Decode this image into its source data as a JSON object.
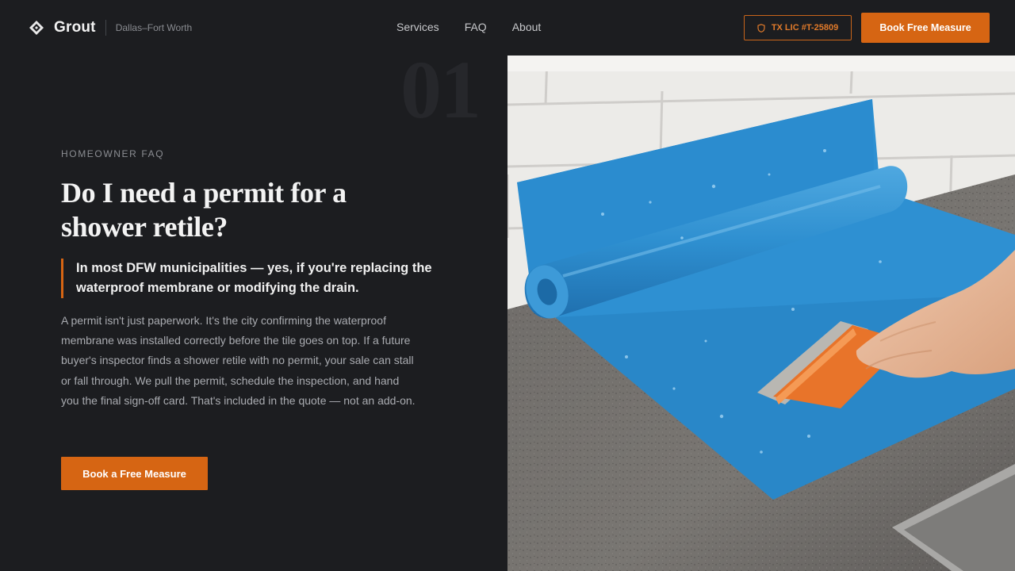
{
  "header": {
    "brand_name": "Grout",
    "city": "Dallas–Fort Worth",
    "nav": [
      "Services",
      "FAQ",
      "About"
    ],
    "license": "TX LIC #T-25809",
    "book_button": "Book Free Measure"
  },
  "hero": {
    "section_number": "01",
    "eyebrow": "HOMEOWNER FAQ",
    "headline": "Do I need a permit for a shower retile?",
    "callout": "In most DFW municipalities — yes, if you're replacing the waterproof membrane or modifying the drain.",
    "body": "A permit isn't just paperwork. It's the city confirming the waterproof membrane was installed correctly before the tile goes on top. If a future buyer's inspector finds a shower retile with no permit, your sale can stall or fall through. We pull the permit, schedule the inspection, and hand you the final sign-off card. That's included in the quote — not an add-on.",
    "cta": "Book a Free Measure"
  },
  "colors": {
    "accent": "#d66513",
    "background": "#1c1d20"
  },
  "icons": {
    "logo": "diamond-logo-icon",
    "license": "shield-icon"
  }
}
